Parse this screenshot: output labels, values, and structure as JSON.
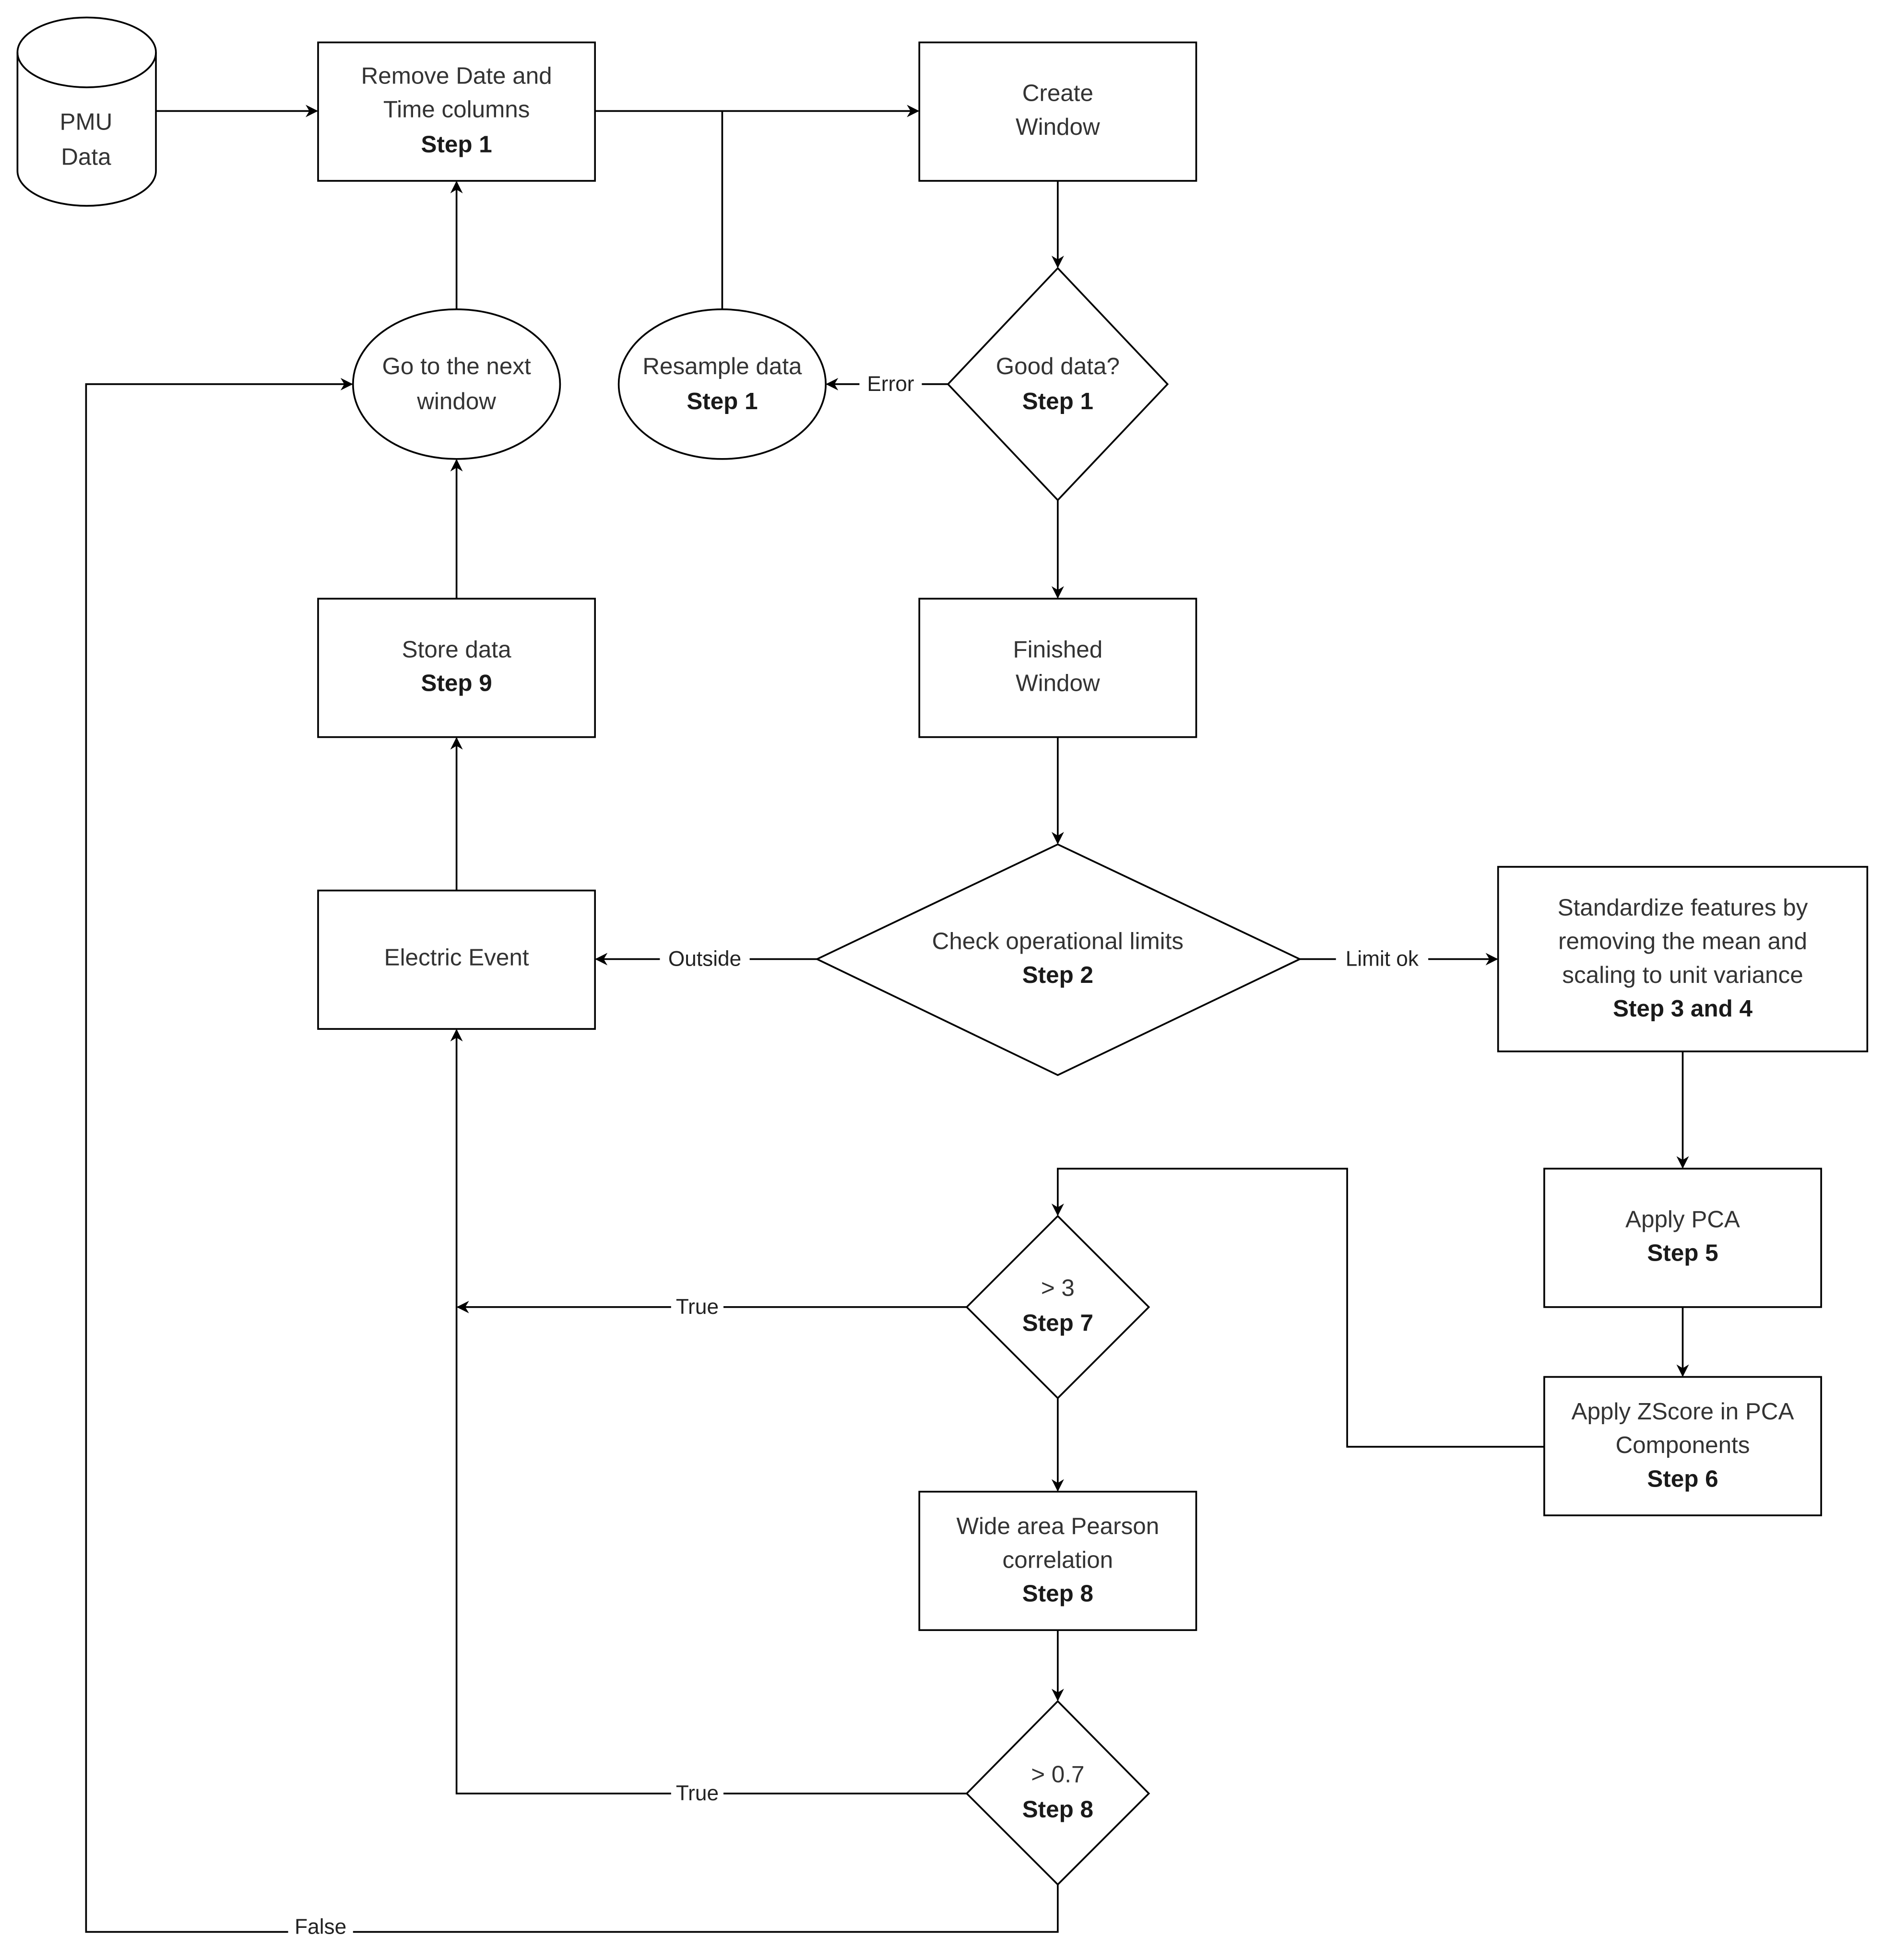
{
  "diagram": {
    "type": "flowchart",
    "nodes": {
      "pmu_data": {
        "shape": "cylinder",
        "lines": [
          "PMU",
          "Data"
        ]
      },
      "remove_cols": {
        "shape": "rect",
        "lines": [
          "Remove Date and",
          "Time columns"
        ],
        "step": "Step 1"
      },
      "create_window": {
        "shape": "rect",
        "lines": [
          "Create",
          "Window"
        ],
        "step": ""
      },
      "good_data": {
        "shape": "diamond",
        "lines": [
          "Good data?"
        ],
        "step": "Step 1"
      },
      "resample": {
        "shape": "ellipse",
        "lines": [
          "Resample data"
        ],
        "step": "Step 1"
      },
      "next_window": {
        "shape": "ellipse",
        "lines": [
          "Go to the next",
          "window"
        ],
        "step": ""
      },
      "finished_window": {
        "shape": "rect",
        "lines": [
          "Finished",
          "Window"
        ],
        "step": ""
      },
      "store_data": {
        "shape": "rect",
        "lines": [
          "Store data"
        ],
        "step": "Step 9"
      },
      "electric_event": {
        "shape": "rect",
        "lines": [
          "Electric Event"
        ],
        "step": ""
      },
      "check_limits": {
        "shape": "diamond",
        "lines": [
          "Check operational limits"
        ],
        "step": "Step 2"
      },
      "standardize": {
        "shape": "rect",
        "lines": [
          "Standardize features by",
          "removing the mean and",
          "scaling to unit variance"
        ],
        "step": "Step 3 and 4"
      },
      "apply_pca": {
        "shape": "rect",
        "lines": [
          "Apply PCA"
        ],
        "step": "Step 5"
      },
      "zscore": {
        "shape": "rect",
        "lines": [
          "Apply ZScore in PCA",
          "Components"
        ],
        "step": "Step 6"
      },
      "gt3": {
        "shape": "diamond",
        "lines": [
          "> 3"
        ],
        "step": "Step 7"
      },
      "pearson": {
        "shape": "rect",
        "lines": [
          "Wide area Pearson",
          "correlation"
        ],
        "step": "Step 8"
      },
      "gt07": {
        "shape": "diamond",
        "lines": [
          "> 0.7"
        ],
        "step": "Step 8"
      }
    },
    "edges": [
      {
        "from": "pmu_data",
        "to": "remove_cols",
        "label": ""
      },
      {
        "from": "remove_cols",
        "to": "create_window",
        "label": ""
      },
      {
        "from": "resample",
        "to": "create_window",
        "label": ""
      },
      {
        "from": "create_window",
        "to": "good_data",
        "label": ""
      },
      {
        "from": "good_data",
        "to": "resample",
        "label": "Error"
      },
      {
        "from": "good_data",
        "to": "finished_window",
        "label": ""
      },
      {
        "from": "next_window",
        "to": "remove_cols",
        "label": ""
      },
      {
        "from": "store_data",
        "to": "next_window",
        "label": ""
      },
      {
        "from": "electric_event",
        "to": "store_data",
        "label": ""
      },
      {
        "from": "finished_window",
        "to": "check_limits",
        "label": ""
      },
      {
        "from": "check_limits",
        "to": "electric_event",
        "label": "Outside"
      },
      {
        "from": "check_limits",
        "to": "standardize",
        "label": "Limit ok"
      },
      {
        "from": "standardize",
        "to": "apply_pca",
        "label": ""
      },
      {
        "from": "apply_pca",
        "to": "zscore",
        "label": ""
      },
      {
        "from": "zscore",
        "to": "gt3",
        "label": ""
      },
      {
        "from": "gt3",
        "to": "electric_event",
        "label": "True"
      },
      {
        "from": "gt3",
        "to": "pearson",
        "label": ""
      },
      {
        "from": "pearson",
        "to": "gt07",
        "label": ""
      },
      {
        "from": "gt07",
        "to": "electric_event",
        "label": "True"
      },
      {
        "from": "gt07",
        "to": "next_window",
        "label": "False"
      }
    ],
    "edge_labels": {
      "error": "Error",
      "outside": "Outside",
      "limit_ok": "Limit ok",
      "true_gt3": "True",
      "true_gt07": "True",
      "false_gt07": "False"
    }
  }
}
